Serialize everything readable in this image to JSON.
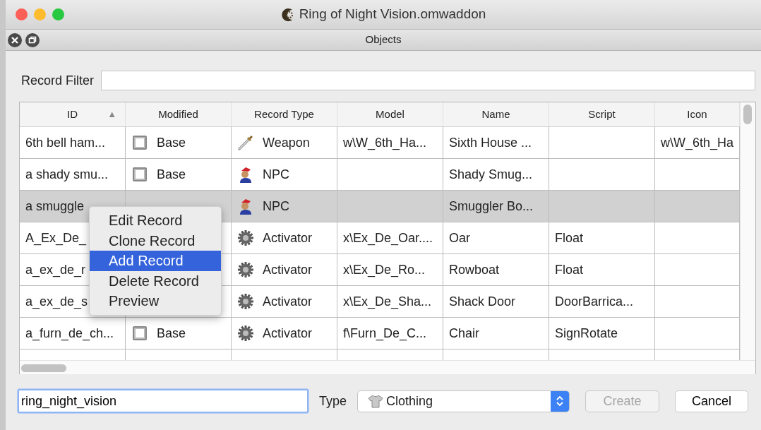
{
  "window": {
    "title": "Ring of Night Vision.omwaddon"
  },
  "subwindow": {
    "title": "Objects"
  },
  "record_filter": {
    "label": "Record Filter"
  },
  "table": {
    "columns": [
      {
        "label": "ID",
        "sort": "▲"
      },
      {
        "label": "Modified"
      },
      {
        "label": "Record Type"
      },
      {
        "label": "Model"
      },
      {
        "label": "Name"
      },
      {
        "label": "Script"
      },
      {
        "label": "Icon"
      }
    ],
    "rows": [
      {
        "id": "6th bell ham...",
        "modified": "Base",
        "kind": "weapon",
        "record_type": "Weapon",
        "model": "w\\W_6th_Ha...",
        "name": "Sixth House ...",
        "icon": "w\\W_6th_Ha",
        "selected": false
      },
      {
        "id": "a shady smu...",
        "modified": "Base",
        "kind": "npc",
        "record_type": "NPC",
        "name": "Shady Smug...",
        "selected": false
      },
      {
        "id": "a smuggle",
        "kind": "npc",
        "record_type": "NPC",
        "name": "Smuggler Bo...",
        "selected": true
      },
      {
        "id": "A_Ex_De_",
        "kind": "activator",
        "record_type": "Activator",
        "model": "x\\Ex_De_Oar....",
        "name": "Oar",
        "script": "Float",
        "selected": false
      },
      {
        "id": "a_ex_de_r",
        "kind": "activator",
        "record_type": "Activator",
        "model": "x\\Ex_De_Ro...",
        "name": "Rowboat",
        "script": "Float",
        "selected": false
      },
      {
        "id": "a_ex_de_s",
        "kind": "activator",
        "record_type": "Activator",
        "model": "x\\Ex_De_Sha...",
        "name": "Shack Door",
        "script": "DoorBarrica...",
        "selected": false
      },
      {
        "id": "a_furn_de_ch...",
        "modified": "Base",
        "kind": "activator",
        "record_type": "Activator",
        "model": "f\\Furn_De_C...",
        "name": "Chair",
        "script": "SignRotate",
        "selected": false
      }
    ]
  },
  "context_menu": [
    {
      "label": "Edit Record",
      "selected": false
    },
    {
      "label": "Clone Record",
      "selected": false
    },
    {
      "label": "Add Record",
      "selected": true
    },
    {
      "label": "Delete Record",
      "selected": false
    },
    {
      "label": "Preview",
      "selected": false
    }
  ],
  "new_record": {
    "value": "ring_night_vision",
    "type_label": "Type",
    "type_value": "Clothing",
    "buttons": [
      {
        "label": "Create",
        "disabled": true
      },
      {
        "label": "Cancel",
        "disabled": false
      }
    ]
  }
}
